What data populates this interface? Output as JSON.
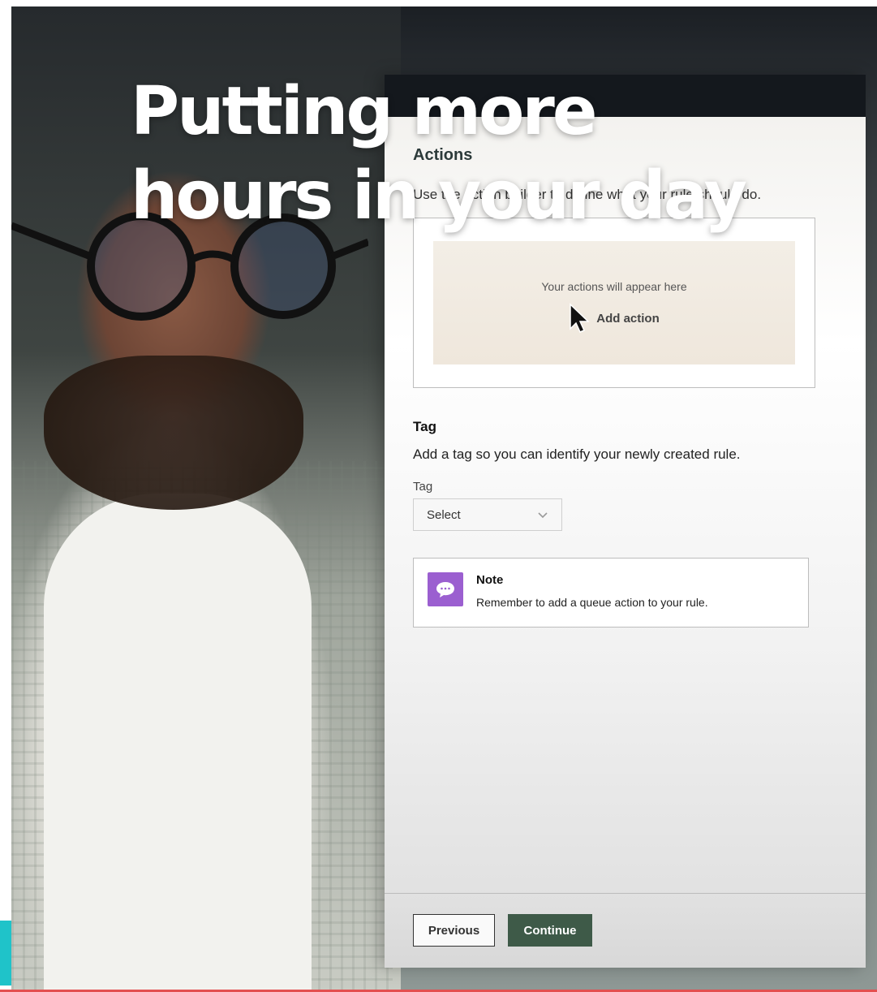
{
  "headline": {
    "line1": "Putting more",
    "line2": "hours in your day"
  },
  "actions": {
    "heading": "Actions",
    "description": "Use the action builder to define what your rule should do.",
    "placeholder": "Your actions will appear here",
    "add_label": "Add action"
  },
  "tag": {
    "heading": "Tag",
    "description": "Add a tag so you can identify your newly created rule.",
    "field_label": "Tag",
    "select_value": "Select"
  },
  "note": {
    "title": "Note",
    "text": "Remember to add a queue action to your rule.",
    "icon": "chat-bubble-icon"
  },
  "footer": {
    "previous_label": "Previous",
    "continue_label": "Continue"
  },
  "colors": {
    "note_icon_bg": "#9b5fd0",
    "continue_bg": "#3e5a48",
    "accent_teal": "#1fc3c9"
  }
}
